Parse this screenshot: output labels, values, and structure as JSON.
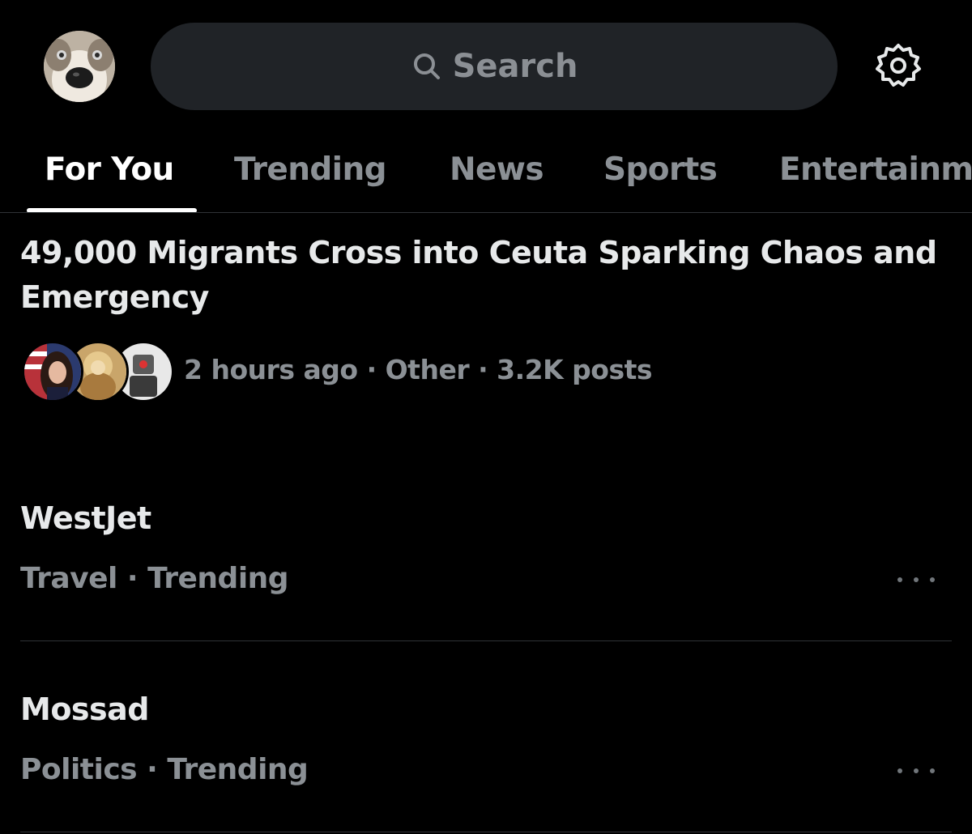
{
  "header": {
    "avatar_icon": "profile-avatar-dog",
    "search": {
      "placeholder": "Search",
      "icon": "search-icon"
    },
    "settings_icon": "gear-icon"
  },
  "tabs": [
    {
      "label": "For You",
      "active": true
    },
    {
      "label": "Trending",
      "active": false
    },
    {
      "label": "News",
      "active": false
    },
    {
      "label": "Sports",
      "active": false
    },
    {
      "label": "Entertainment",
      "active": false
    }
  ],
  "story": {
    "title": "49,000 Migrants Cross into Ceuta Sparking Chaos and Emergency",
    "time": "2 hours ago",
    "category": "Other",
    "posts": "3.2K posts",
    "separator": "·"
  },
  "trends": [
    {
      "name": "WestJet",
      "category": "Travel",
      "status": "Trending"
    },
    {
      "name": "Mossad",
      "category": "Politics",
      "status": "Trending"
    }
  ],
  "colors": {
    "background": "#000000",
    "primary_text": "#e7e9ea",
    "secondary_text": "#8b9095",
    "search_bg": "#202327",
    "divider": "#2f3336"
  }
}
